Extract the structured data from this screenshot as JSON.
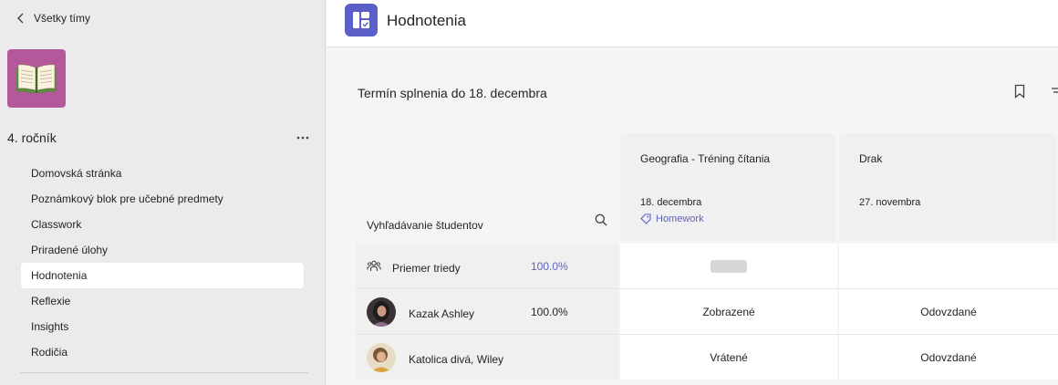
{
  "sidebar": {
    "back_label": "Všetky tímy",
    "team_name": "4. ročník",
    "more_label": "···",
    "nav": [
      {
        "label": "Domovská stránka"
      },
      {
        "label": "Poznámkový blok pre učebné predmety"
      },
      {
        "label": "Classwork"
      },
      {
        "label": "Priradené úlohy"
      },
      {
        "label": "Hodnotenia"
      },
      {
        "label": "Reflexie"
      },
      {
        "label": "Insights"
      },
      {
        "label": "Rodičia"
      }
    ]
  },
  "header": {
    "title": "Hodnotenia"
  },
  "grades": {
    "due_heading": "Termín splnenia do 18. decembra",
    "search_label": "Vyhľadávanie študentov",
    "assignments": [
      {
        "title": "Geografia - Tréning čítania",
        "date": "18. decembra",
        "tag": "Homework"
      },
      {
        "title": "Drak",
        "date": "27. novembra",
        "tag": ""
      }
    ],
    "class_average": {
      "label": "Priemer triedy",
      "value": "100.0%"
    },
    "students": [
      {
        "name": "Kazak Ashley",
        "average": "100.0%",
        "status1": "Zobrazené",
        "status2": "Odovzdané"
      },
      {
        "name": "Katolica divá, Wiley",
        "average": "",
        "status1": "Vrátené",
        "status2": "Odovzdané"
      }
    ]
  },
  "colors": {
    "accent": "#5b5fc7",
    "team_avatar": "#b4579b"
  }
}
